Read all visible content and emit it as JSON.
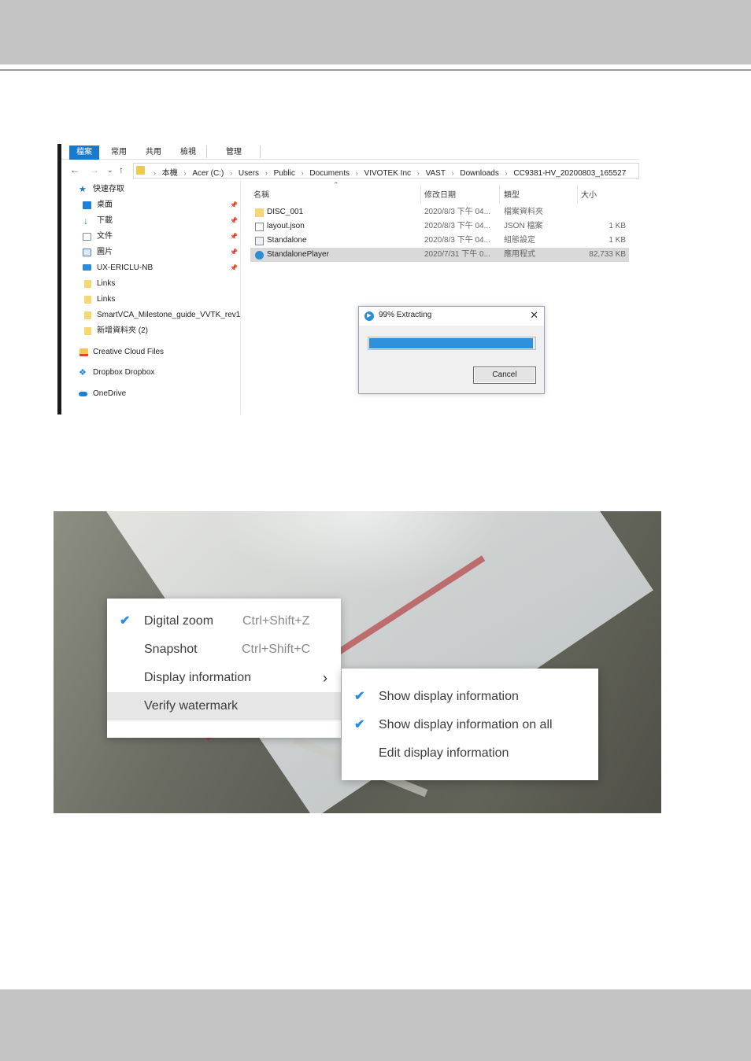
{
  "explorer": {
    "ribbon_tabs": [
      "檔案",
      "常用",
      "共用",
      "檢視",
      "管理"
    ],
    "nav_buttons": {
      "back": "←",
      "forward": "→",
      "recent": "⌄",
      "up": "↑"
    },
    "breadcrumbs": [
      "本機",
      "Acer (C:)",
      "Users",
      "Public",
      "Documents",
      "VIVOTEK Inc",
      "VAST",
      "Downloads",
      "CC9381-HV_20200803_165527"
    ],
    "crumb_sep": "›",
    "nav_items": [
      {
        "label": "快速存取",
        "icon": "star-icon"
      },
      {
        "label": "桌面",
        "icon": "desktop-icon",
        "pinned": true
      },
      {
        "label": "下載",
        "icon": "download-icon",
        "pinned": true
      },
      {
        "label": "文件",
        "icon": "document-icon",
        "pinned": true
      },
      {
        "label": "圖片",
        "icon": "picture-icon",
        "pinned": true
      },
      {
        "label": "UX-ERICLU-NB",
        "icon": "computer-icon",
        "pinned": true
      },
      {
        "label": "Links",
        "icon": "folder-icon"
      },
      {
        "label": "Links",
        "icon": "folder-icon"
      },
      {
        "label": "SmartVCA_Milestone_guide_VVTK_rev1",
        "icon": "folder-icon"
      },
      {
        "label": "新增資料夾 (2)",
        "icon": "folder-icon"
      },
      {
        "label": "Creative Cloud Files",
        "icon": "creative-cloud-icon"
      },
      {
        "label": "Dropbox Dropbox",
        "icon": "dropbox-icon"
      },
      {
        "label": "OneDrive",
        "icon": "onedrive-icon"
      }
    ],
    "pin_glyph": "📌",
    "columns": {
      "name": "名稱",
      "date": "修改日期",
      "type": "類型",
      "size": "大小"
    },
    "files": [
      {
        "name": "DISC_001",
        "date": "2020/8/3 下午 04...",
        "type": "檔案資料夾",
        "size": "",
        "icon": "folder-icon"
      },
      {
        "name": "layout.json",
        "date": "2020/8/3 下午 04...",
        "type": "JSON 檔案",
        "size": "1 KB",
        "icon": "file-icon"
      },
      {
        "name": "Standalone",
        "date": "2020/8/3 下午 04...",
        "type": "組態設定",
        "size": "1 KB",
        "icon": "config-file-icon"
      },
      {
        "name": "StandalonePlayer",
        "date": "2020/7/31 下午 0...",
        "type": "應用程式",
        "size": "82,733 KB",
        "icon": "player-app-icon"
      }
    ],
    "dialog": {
      "title": "99% Extracting",
      "progress": 0.99,
      "cancel": "Cancel",
      "close": "✕"
    }
  },
  "player_menu": {
    "main": [
      {
        "label": "Digital zoom",
        "shortcut": "Ctrl+Shift+Z",
        "checked": true
      },
      {
        "label": "Snapshot",
        "shortcut": "Ctrl+Shift+C",
        "checked": false
      },
      {
        "label": "Display information",
        "shortcut": "",
        "submenu": true
      },
      {
        "label": "Verify watermark",
        "shortcut": "",
        "highlighted": true
      }
    ],
    "submenu": [
      {
        "label": "Show display information",
        "checked": true
      },
      {
        "label": "Show display information on all",
        "checked": true
      },
      {
        "label": "Edit display information",
        "checked": false
      }
    ],
    "check_glyph": "✔",
    "chevron_glyph": "›"
  },
  "colors": {
    "accent": "#1979ca",
    "progress": "#2e91da",
    "check": "#2b8be0",
    "band": "#c4c4c4"
  }
}
